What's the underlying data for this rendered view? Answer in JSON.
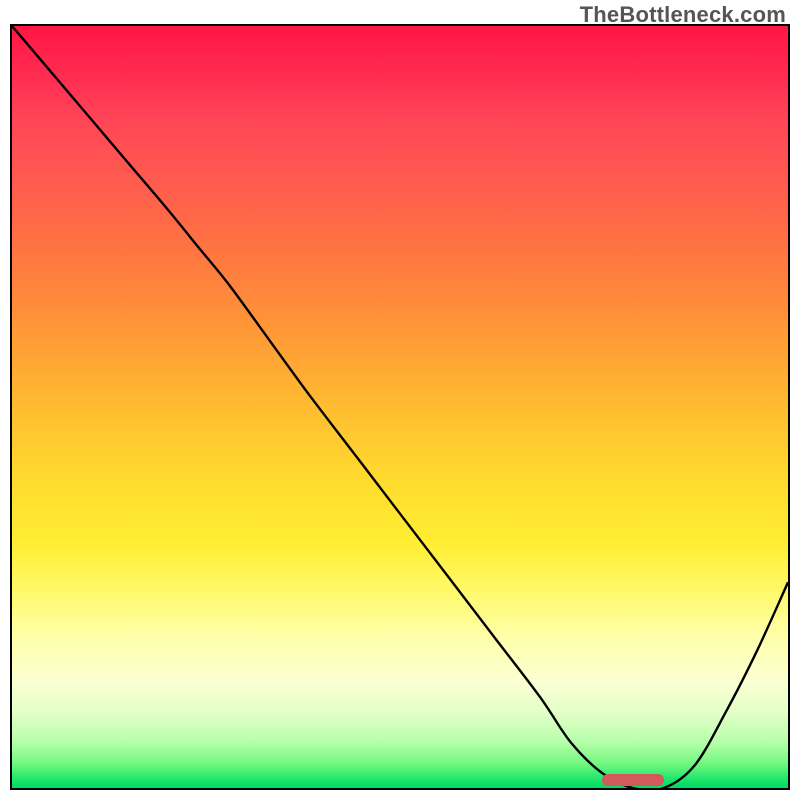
{
  "watermark": "TheBottleneck.com",
  "chart_data": {
    "type": "line",
    "title": "",
    "xlabel": "",
    "ylabel": "",
    "xlim": [
      0,
      100
    ],
    "ylim": [
      0,
      100
    ],
    "grid": false,
    "series": [
      {
        "name": "bottleneck_curve",
        "x": [
          0,
          5,
          10,
          15,
          20,
          24,
          28,
          33,
          38,
          44,
          50,
          56,
          62,
          68,
          72,
          76,
          80,
          84,
          88,
          92,
          96,
          100
        ],
        "y": [
          100,
          94,
          88,
          82,
          76,
          71,
          66,
          59,
          52,
          44,
          36,
          28,
          20,
          12,
          6,
          2,
          0,
          0,
          3,
          10,
          18,
          27
        ]
      }
    ],
    "optimal_range_x": [
      76,
      84
    ],
    "marker_color": "#d15a5a",
    "gradient": {
      "top": "#ff1744",
      "mid_upper": "#ff8a3a",
      "mid": "#ffee33",
      "mid_lower": "#fbffd2",
      "bottom": "#00d964"
    }
  }
}
